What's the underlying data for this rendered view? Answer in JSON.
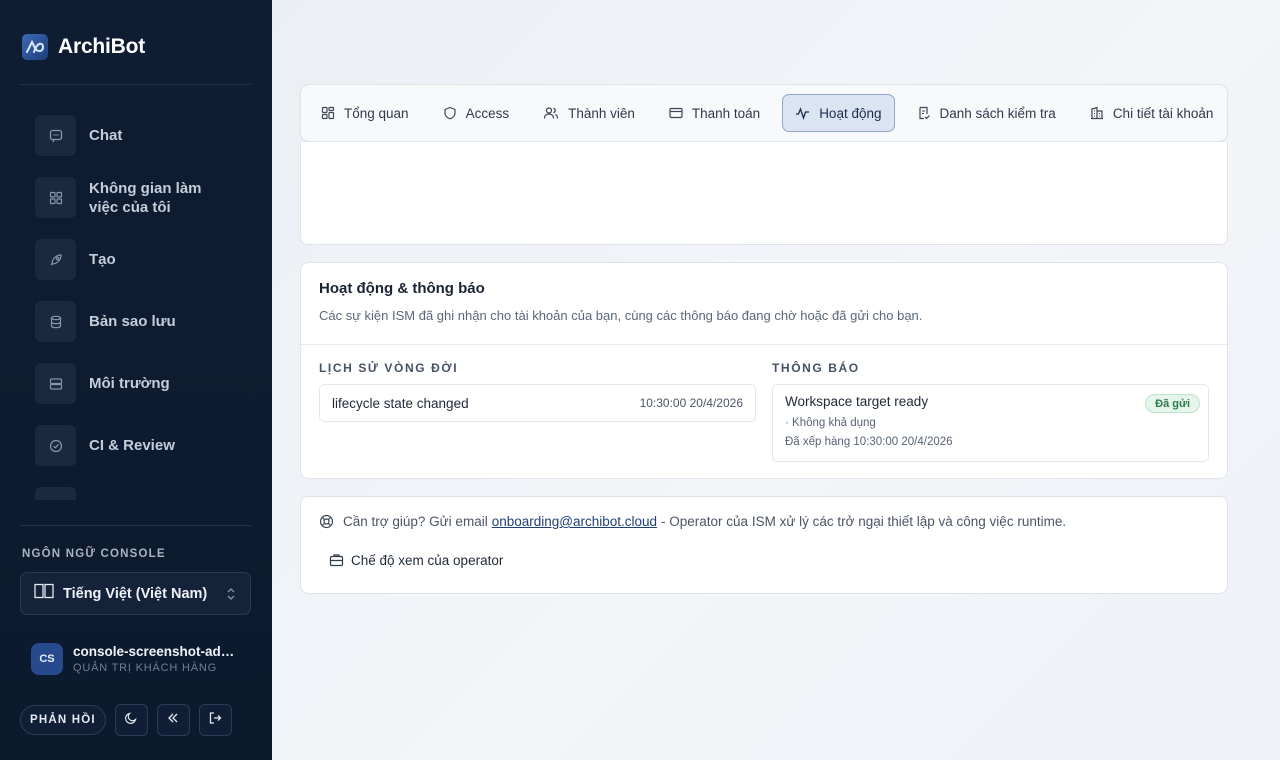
{
  "brand": {
    "name": "ArchiBot"
  },
  "sidebar": {
    "items": [
      {
        "label": "Chat",
        "icon": "chat-icon"
      },
      {
        "label": "Không gian làm việc của tôi",
        "icon": "grid-icon"
      },
      {
        "label": "Tạo",
        "icon": "rocket-icon"
      },
      {
        "label": "Bản sao lưu",
        "icon": "database-icon"
      },
      {
        "label": "Môi trường",
        "icon": "server-icon"
      },
      {
        "label": "CI & Review",
        "icon": "check-circle-icon"
      }
    ],
    "language_title": "NGÔN NGỮ CONSOLE",
    "language_value": "Tiếng Việt (Việt Nam)",
    "user": {
      "initials": "CS",
      "name": "console-screenshot-adm...",
      "role": "QUẢN TRỊ KHÁCH HÀNG"
    },
    "feedback_label": "PHẢN HỒI"
  },
  "tabs": [
    {
      "label": "Tổng quan",
      "icon": "grid-icon",
      "active": false
    },
    {
      "label": "Access",
      "icon": "shield-icon",
      "active": false
    },
    {
      "label": "Thành viên",
      "icon": "users-icon",
      "active": false
    },
    {
      "label": "Thanh toán",
      "icon": "credit-card-icon",
      "active": false
    },
    {
      "label": "Hoạt động",
      "icon": "activity-icon",
      "active": true
    },
    {
      "label": "Danh sách kiểm tra",
      "icon": "checklist-icon",
      "active": false
    },
    {
      "label": "Chi tiết tài khoản",
      "icon": "building-icon",
      "active": false
    }
  ],
  "activity": {
    "title": "Hoạt động & thông báo",
    "subtitle": "Các sự kiện ISM đã ghi nhận cho tài khoản của bạn, cùng các thông báo đang chờ hoặc đã gửi cho bạn.",
    "lifecycle": {
      "title": "LỊCH SỬ VÒNG ĐỜI",
      "events": [
        {
          "text": "lifecycle state changed",
          "time": "10:30:00 20/4/2026"
        }
      ]
    },
    "notifications": {
      "title": "THÔNG BÁO",
      "items": [
        {
          "title": "Workspace target ready",
          "status": "Đã gửi",
          "meta": "· Không khả dụng",
          "queued": "Đã xếp hàng 10:30:00 20/4/2026"
        }
      ]
    }
  },
  "help": {
    "prefix": "Cần trợ giúp? Gửi email",
    "email": "onboarding@archibot.cloud",
    "suffix": "- Operator của ISM xử lý các trở ngại thiết lập và công việc runtime.",
    "operator_button": "Chế độ xem của operator"
  },
  "colors": {
    "sidebar_bg": "#0f1d33",
    "accent": "#274a8c",
    "active_tab_bg": "#dbe4f3",
    "badge_green": "#2d7a4a"
  }
}
